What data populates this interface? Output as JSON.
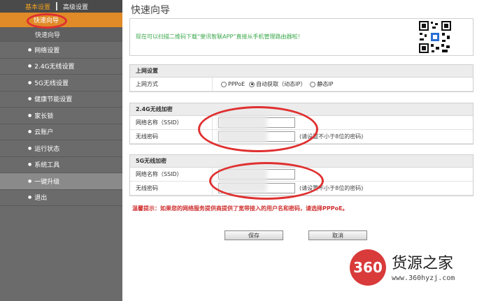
{
  "sidebar": {
    "tabs": [
      "基本设置",
      "高级设置"
    ],
    "items": [
      {
        "label": "快速向导",
        "state": "active"
      },
      {
        "label": "快速向导",
        "state": "sub"
      },
      {
        "label": "网络设置"
      },
      {
        "label": "2.4G无线设置"
      },
      {
        "label": "5G无线设置"
      },
      {
        "label": "健康节能设置"
      },
      {
        "label": "家长锁"
      },
      {
        "label": "云账户"
      },
      {
        "label": "运行状态"
      },
      {
        "label": "系统工具"
      },
      {
        "label": "一键升级",
        "state": "hl"
      },
      {
        "label": "退出"
      }
    ]
  },
  "main": {
    "title": "快速向导",
    "notice": "现在可以扫描二维码下载“斐讯智联APP”直接从手机管理路由器啦！",
    "net": {
      "header": "上网设置",
      "mode_label": "上网方式",
      "options": [
        "PPPoE",
        "自动获取（动态IP）",
        "静态IP"
      ],
      "selected": 1
    },
    "wifi24": {
      "header": "2.4G无线加密",
      "ssid_label": "网络名称（SSID）",
      "pwd_label": "无线密码",
      "pwd_hint": "(请设置不小于8位的密码)"
    },
    "wifi5": {
      "header": "5G无线加密",
      "ssid_label": "网络名称（SSID）",
      "pwd_label": "无线密码",
      "pwd_hint": "(请设置不小于8位的密码)"
    },
    "tip": "温馨提示：如果您的网络服务提供商提供了宽带接入的用户名和密码，请选择PPPoE。",
    "save": "保存",
    "cancel": "取消"
  },
  "watermark": {
    "logo": "360",
    "name": "货源之家",
    "url": "www.360hyzj.com"
  },
  "colors": {
    "sidebar_bg": "#6b6b6b",
    "active": "#e08a28",
    "notice": "#3aa74a",
    "tip": "#d03030",
    "annotation": "#e03030"
  }
}
